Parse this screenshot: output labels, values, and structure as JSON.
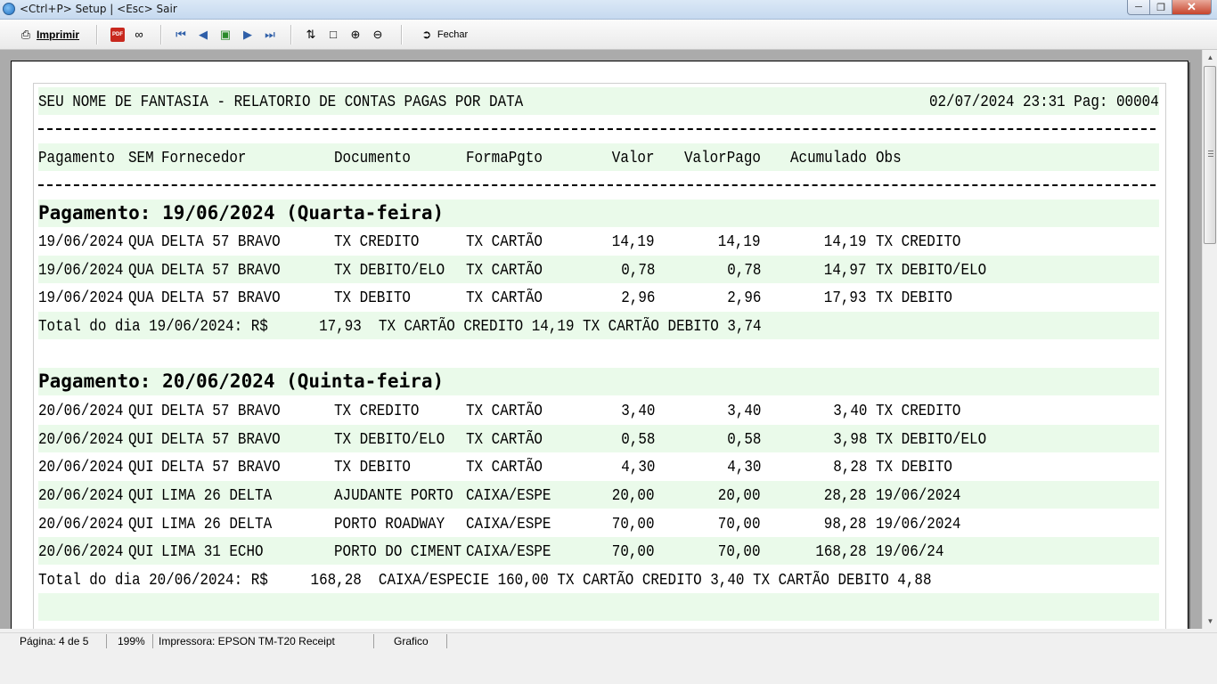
{
  "window": {
    "title": "<Ctrl+P> Setup | <Esc> Sair"
  },
  "toolbar": {
    "print_label": "Imprimir",
    "close_label": "Fechar",
    "icons": [
      "printer-icon",
      "pdf-icon",
      "find-icon",
      "first-page-icon",
      "prev-page-icon",
      "goto-page-icon",
      "next-page-icon",
      "last-page-icon",
      "page-width-icon",
      "whole-page-icon",
      "zoom-in-icon",
      "zoom-out-icon",
      "close-icon"
    ]
  },
  "report": {
    "header_left": "SEU NOME DE FANTASIA - RELATORIO DE CONTAS PAGAS POR DATA",
    "header_right": "02/07/2024 23:31 Pag: 00004",
    "columns": [
      "Pagamento",
      "SEM",
      "Fornecedor",
      "Documento",
      "FormaPgto",
      "Valor",
      "ValorPago",
      "Acumulado",
      "Obs"
    ],
    "day1": {
      "heading": "Pagamento: 19/06/2024 (Quarta-feira)",
      "rows": [
        [
          "19/06/2024",
          "QUA",
          "DELTA 57 BRAVO",
          "TX CREDITO",
          "TX CARTÃO",
          "14,19",
          "14,19",
          "14,19",
          "TX CREDITO"
        ],
        [
          "19/06/2024",
          "QUA",
          "DELTA 57 BRAVO",
          "TX DEBITO/ELO",
          "TX CARTÃO",
          "0,78",
          "0,78",
          "14,97",
          "TX DEBITO/ELO"
        ],
        [
          "19/06/2024",
          "QUA",
          "DELTA 57 BRAVO",
          "TX DEBITO",
          "TX CARTÃO",
          "2,96",
          "2,96",
          "17,93",
          "TX DEBITO"
        ]
      ],
      "total": "Total do dia 19/06/2024: R$      17,93  TX CARTÃO CREDITO 14,19 TX CARTÃO DEBITO 3,74"
    },
    "day2": {
      "heading": "Pagamento: 20/06/2024 (Quinta-feira)",
      "rows": [
        [
          "20/06/2024",
          "QUI",
          "DELTA 57 BRAVO",
          "TX CREDITO",
          "TX CARTÃO",
          "3,40",
          "3,40",
          "3,40",
          "TX CREDITO"
        ],
        [
          "20/06/2024",
          "QUI",
          "DELTA 57 BRAVO",
          "TX DEBITO/ELO",
          "TX CARTÃO",
          "0,58",
          "0,58",
          "3,98",
          "TX DEBITO/ELO"
        ],
        [
          "20/06/2024",
          "QUI",
          "DELTA 57 BRAVO",
          "TX DEBITO",
          "TX CARTÃO",
          "4,30",
          "4,30",
          "8,28",
          "TX DEBITO"
        ],
        [
          "20/06/2024",
          "QUI",
          "LIMA 26 DELTA",
          "AJUDANTE PORTO",
          "CAIXA/ESPE",
          "20,00",
          "20,00",
          "28,28",
          "19/06/2024"
        ],
        [
          "20/06/2024",
          "QUI",
          "LIMA 26 DELTA",
          "PORTO ROADWAY",
          "CAIXA/ESPE",
          "70,00",
          "70,00",
          "98,28",
          "19/06/2024"
        ],
        [
          "20/06/2024",
          "QUI",
          "LIMA 31 ECHO",
          "PORTO DO CIMENT",
          "CAIXA/ESPE",
          "70,00",
          "70,00",
          "168,28",
          "19/06/24"
        ]
      ],
      "total": "Total do dia 20/06/2024: R$     168,28  CAIXA/ESPECIE 160,00 TX CARTÃO CREDITO 3,40 TX CARTÃO DEBITO 4,88"
    }
  },
  "status": {
    "page": "Página: 4 de 5",
    "zoom": "199%",
    "printer": "Impressora: EPSON TM-T20 Receipt",
    "mode": "Grafico"
  }
}
